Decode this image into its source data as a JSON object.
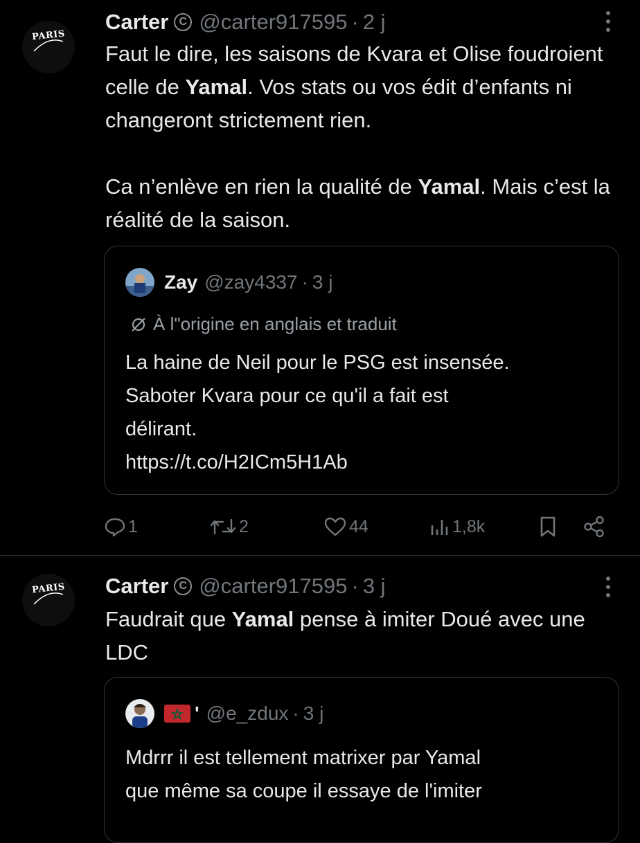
{
  "tweets": [
    {
      "author": {
        "name": "Carter",
        "badge_symbol": "C",
        "handle": "@carter917595",
        "time": "2 j",
        "avatar_text": "PARIS"
      },
      "separator": "·",
      "text": {
        "p1_a": "Faut le dire, les saisons de Kvara et Olise foudroient celle de ",
        "p1_bold": "Yamal",
        "p1_b": ". Vos stats ou vos édit d’enfants ni changeront strictement rien.",
        "p2_a": "Ca n’enlève en rien la qualité de ",
        "p2_bold": "Yamal",
        "p2_b": ". Mais c’est la réalité de la saison."
      },
      "quote": {
        "name": "Zay",
        "handle": "@zay4337",
        "time": "3 j",
        "translation_note": "À l\"origine en anglais et traduit",
        "lines": [
          "La haine de Neil pour le PSG est insensée.",
          "Saboter Kvara pour ce qu'il a fait est",
          "délirant.",
          "https://t.co/H2ICm5H1Ab"
        ]
      },
      "actions": {
        "replies": "1",
        "reposts": "2",
        "likes": "44",
        "views": "1,8k"
      }
    },
    {
      "author": {
        "name": "Carter",
        "badge_symbol": "C",
        "handle": "@carter917595",
        "time": "3 j",
        "avatar_text": "PARIS"
      },
      "separator": "·",
      "text": {
        "p1_a": "Faudrait que ",
        "p1_bold": "Yamal",
        "p1_b": " pense à imiter Doué avec une LDC"
      },
      "quote": {
        "name_suffix": "'",
        "handle": "@e_zdux",
        "time": "3 j",
        "lines": [
          "Mdrrr il est tellement matrixer par Yamal",
          "que même sa coupe il essaye de l'imiter"
        ]
      }
    }
  ],
  "colors": {
    "background": "#000000",
    "text": "#e7e9ea",
    "muted": "#71767b",
    "border": "#2f3336"
  },
  "icons": [
    "more-dots-icon",
    "translate-icon",
    "reply-icon",
    "repost-icon",
    "like-icon",
    "views-icon",
    "bookmark-icon",
    "share-icon",
    "morocco-flag-icon"
  ]
}
